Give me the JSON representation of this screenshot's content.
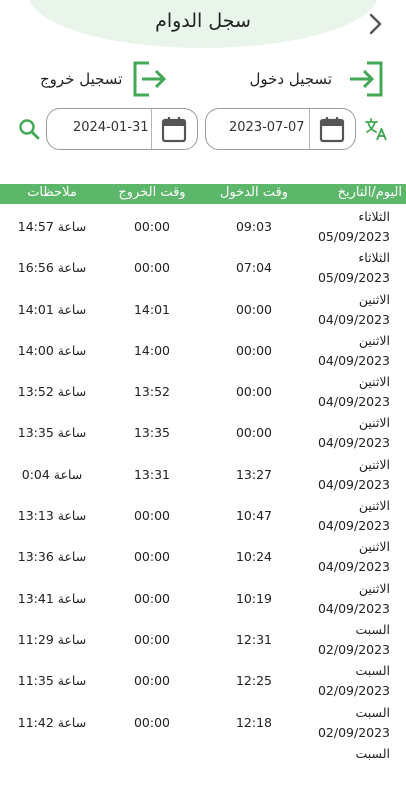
{
  "header": {
    "title": "سجل الدوام"
  },
  "actions": {
    "check_in": "تسجيل دخول",
    "check_out": "تسجيل خروج"
  },
  "filters": {
    "from_date": "2023-07-07",
    "to_date": "2024-01-31"
  },
  "icons": [
    "chevron-right-icon",
    "login-icon",
    "logout-icon",
    "calendar-icon",
    "search-icon",
    "translate-icon"
  ],
  "colors": {
    "accent": "#5cb76a",
    "header_bg": "#e9f4ea"
  },
  "table": {
    "columns": [
      "اليوم/التاريخ",
      "وقت الدخول",
      "وقت الخروج",
      "ملاحظات"
    ],
    "rows": [
      {
        "day": "الثلاثاء",
        "date": "05/09/2023",
        "in": "09:03",
        "out": "00:00",
        "note": "14:57 ساعة"
      },
      {
        "day": "الثلاثاء",
        "date": "05/09/2023",
        "in": "07:04",
        "out": "00:00",
        "note": "16:56 ساعة"
      },
      {
        "day": "الاثنين",
        "date": "04/09/2023",
        "in": "00:00",
        "out": "14:01",
        "note": "14:01 ساعة"
      },
      {
        "day": "الاثنين",
        "date": "04/09/2023",
        "in": "00:00",
        "out": "14:00",
        "note": "14:00 ساعة"
      },
      {
        "day": "الاثنين",
        "date": "04/09/2023",
        "in": "00:00",
        "out": "13:52",
        "note": "13:52 ساعة"
      },
      {
        "day": "الاثنين",
        "date": "04/09/2023",
        "in": "00:00",
        "out": "13:35",
        "note": "13:35 ساعة"
      },
      {
        "day": "الاثنين",
        "date": "04/09/2023",
        "in": "13:27",
        "out": "13:31",
        "note": "0:04 ساعة"
      },
      {
        "day": "الاثنين",
        "date": "04/09/2023",
        "in": "10:47",
        "out": "00:00",
        "note": "13:13 ساعة"
      },
      {
        "day": "الاثنين",
        "date": "04/09/2023",
        "in": "10:24",
        "out": "00:00",
        "note": "13:36 ساعة"
      },
      {
        "day": "الاثنين",
        "date": "04/09/2023",
        "in": "10:19",
        "out": "00:00",
        "note": "13:41 ساعة"
      },
      {
        "day": "السبت",
        "date": "02/09/2023",
        "in": "12:31",
        "out": "00:00",
        "note": "11:29 ساعة"
      },
      {
        "day": "السبت",
        "date": "02/09/2023",
        "in": "12:25",
        "out": "00:00",
        "note": "11:35 ساعة"
      },
      {
        "day": "السبت",
        "date": "02/09/2023",
        "in": "12:18",
        "out": "00:00",
        "note": "11:42 ساعة"
      },
      {
        "day": "السبت",
        "date": "",
        "in": "",
        "out": "",
        "note": ""
      }
    ]
  }
}
